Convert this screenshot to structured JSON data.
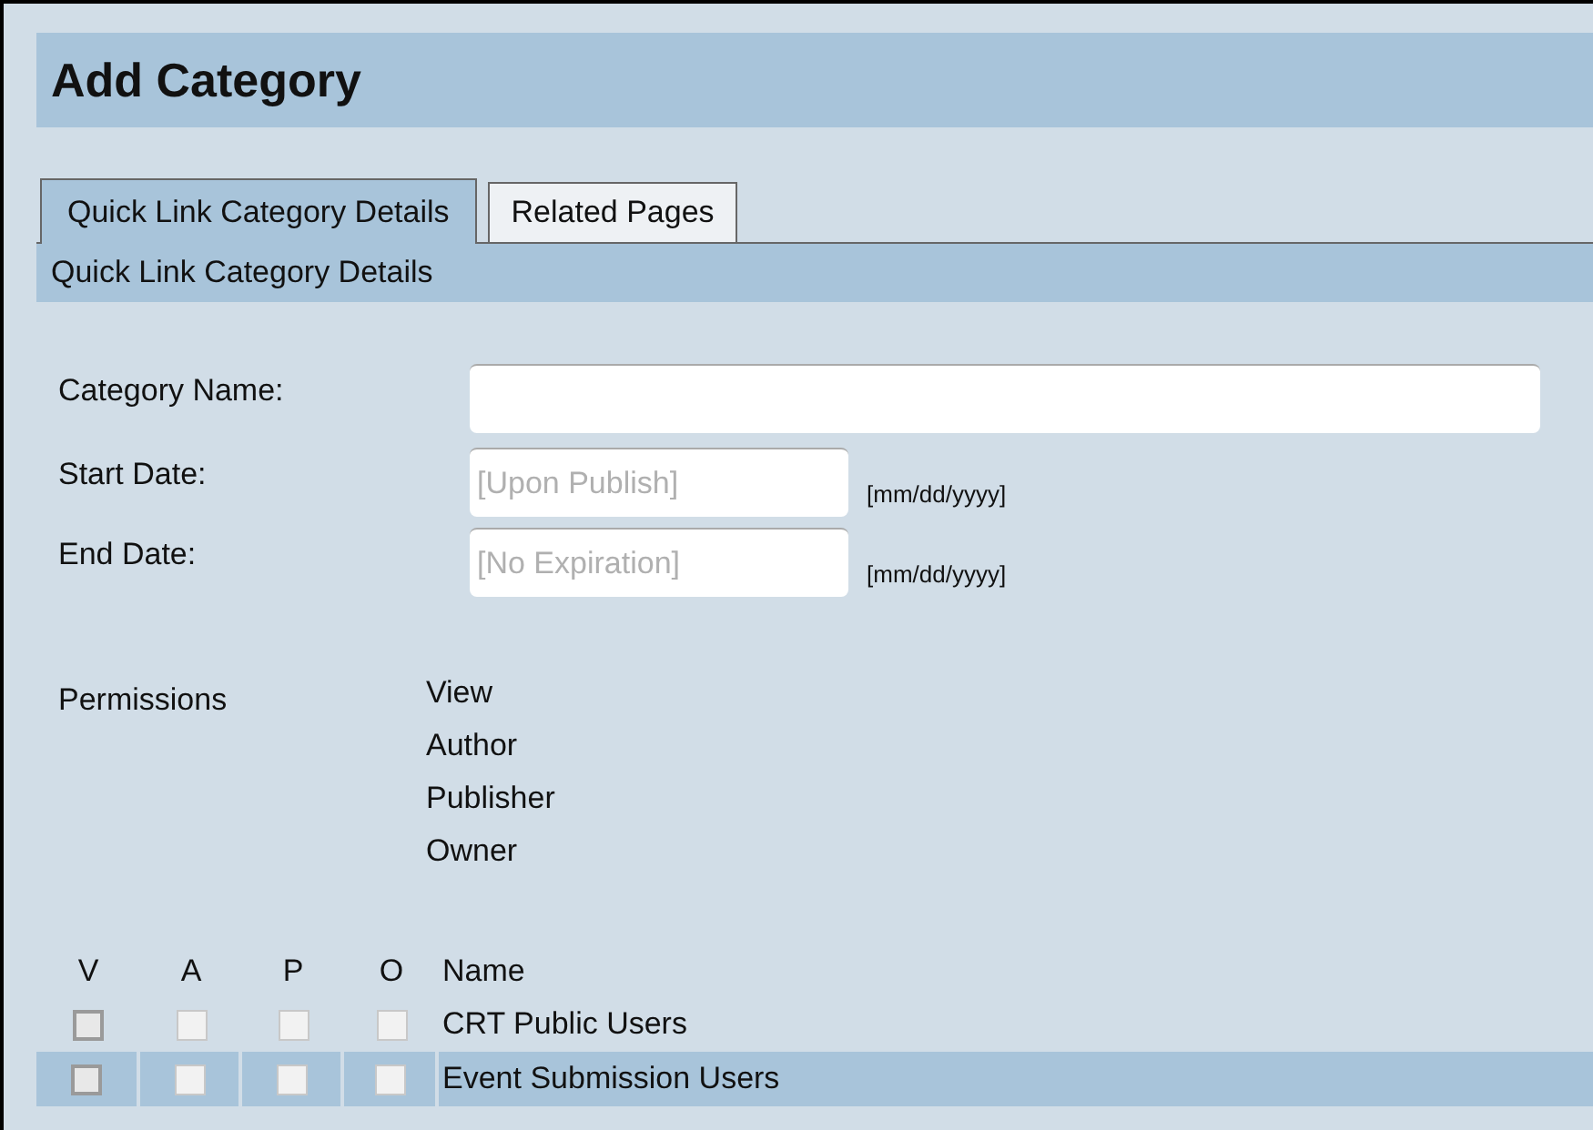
{
  "page_title": "Add Category",
  "tabs": [
    {
      "label": "Quick Link Category Details",
      "selected": true
    },
    {
      "label": "Related Pages",
      "selected": false
    }
  ],
  "section_title": "Quick Link Category Details",
  "fields": [
    {
      "label": "Category Name:",
      "kind": "text"
    },
    {
      "label": "Start Date:",
      "kind": "date",
      "placeholder": "[Upon Publish]",
      "format": "[mm/dd/yyyy]"
    },
    {
      "label": "End Date:",
      "kind": "date",
      "placeholder": "[No Expiration]",
      "format": "[mm/dd/yyyy]"
    }
  ],
  "permissions": {
    "label": "Permissions",
    "levels": [
      "View",
      "Author",
      "Publisher",
      "Owner"
    ]
  },
  "table": {
    "columns": [
      "V",
      "A",
      "P",
      "O",
      "Name"
    ],
    "rows": [
      {
        "name": "CRT Public Users",
        "highlighted": false,
        "checkboxes": [
          {
            "checked": false,
            "disabled": false
          },
          {
            "checked": false,
            "disabled": true
          },
          {
            "checked": false,
            "disabled": true
          },
          {
            "checked": false,
            "disabled": true
          }
        ]
      },
      {
        "name": "Event Submission Users",
        "highlighted": true,
        "checkboxes": [
          {
            "checked": false,
            "disabled": false
          },
          {
            "checked": false,
            "disabled": true
          },
          {
            "checked": false,
            "disabled": true
          },
          {
            "checked": false,
            "disabled": true
          }
        ]
      }
    ]
  }
}
